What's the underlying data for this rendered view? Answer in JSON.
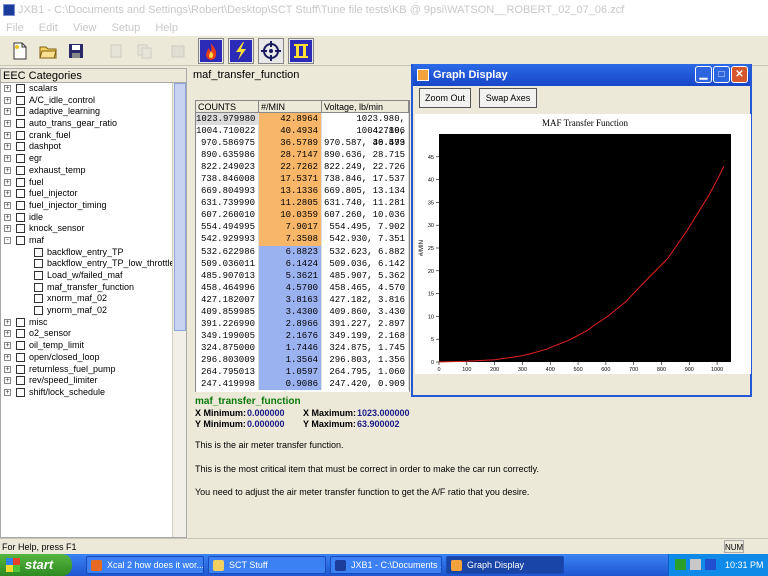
{
  "window": {
    "title": "JXB1 - C:\\Documents and Settings\\Robert\\Desktop\\SCT Stuff\\Tune file tests\\KB @ 9psi\\WATSON__ROBERT_02_07_06.zcf"
  },
  "menu": [
    "File",
    "Edit",
    "View",
    "Setup",
    "Help"
  ],
  "toolbar": {
    "icons": [
      "new-file-icon",
      "open-folder-icon",
      "save-icon",
      "cut-icon",
      "copy-icon",
      "paste-icon",
      "flame-icon",
      "lightning-icon",
      "target-icon",
      "pause-icon"
    ]
  },
  "left": {
    "header": "EEC Categories",
    "tree": [
      {
        "label": "scalars",
        "expander": "+",
        "level": 0
      },
      {
        "label": "A/C_idle_control",
        "expander": "+",
        "level": 0
      },
      {
        "label": "adaptive_learning",
        "expander": "+",
        "level": 0
      },
      {
        "label": "auto_trans_gear_ratio",
        "expander": "+",
        "level": 0
      },
      {
        "label": "crank_fuel",
        "expander": "+",
        "level": 0
      },
      {
        "label": "dashpot",
        "expander": "+",
        "level": 0
      },
      {
        "label": "egr",
        "expander": "+",
        "level": 0
      },
      {
        "label": "exhaust_temp",
        "expander": "+",
        "level": 0
      },
      {
        "label": "fuel",
        "expander": "+",
        "level": 0
      },
      {
        "label": "fuel_injector",
        "expander": "+",
        "level": 0
      },
      {
        "label": "fuel_injector_timing",
        "expander": "+",
        "level": 0
      },
      {
        "label": "idle",
        "expander": "+",
        "level": 0
      },
      {
        "label": "knock_sensor",
        "expander": "+",
        "level": 0
      },
      {
        "label": "maf",
        "expander": "-",
        "level": 0
      },
      {
        "label": "backflow_entry_TP",
        "expander": "",
        "level": 1
      },
      {
        "label": "backflow_entry_TP_low_throttle",
        "expander": "",
        "level": 1
      },
      {
        "label": "Load_w/failed_maf",
        "expander": "",
        "level": 1
      },
      {
        "label": "maf_transfer_function",
        "expander": "",
        "level": 1
      },
      {
        "label": "xnorm_maf_02",
        "expander": "",
        "level": 1
      },
      {
        "label": "ynorm_maf_02",
        "expander": "",
        "level": 1
      },
      {
        "label": "misc",
        "expander": "+",
        "level": 0
      },
      {
        "label": "o2_sensor",
        "expander": "+",
        "level": 0
      },
      {
        "label": "oil_temp_limit",
        "expander": "+",
        "level": 0
      },
      {
        "label": "open/closed_loop",
        "expander": "+",
        "level": 0
      },
      {
        "label": "returnless_fuel_pump",
        "expander": "+",
        "level": 0
      },
      {
        "label": "rev/speed_limiter",
        "expander": "+",
        "level": 0
      },
      {
        "label": "shift/lock_schedule",
        "expander": "+",
        "level": 0
      }
    ]
  },
  "main": {
    "header": "maf_transfer_function",
    "columns": [
      "COUNTS",
      "#/MIN",
      "Voltage, lb/min"
    ],
    "rows": [
      [
        "1023.979980",
        "42.8964",
        "1023.980, 42.896"
      ],
      [
        "1004.710022",
        "40.4934",
        "1004.710, 40.493"
      ],
      [
        "970.586975",
        "36.5789",
        "970.587, 36.579"
      ],
      [
        "890.635986",
        "28.7147",
        "890.636, 28.715"
      ],
      [
        "822.249023",
        "22.7262",
        "822.249, 22.726"
      ],
      [
        "738.846008",
        "17.5371",
        "738.846, 17.537"
      ],
      [
        "669.804993",
        "13.1336",
        "669.805, 13.134"
      ],
      [
        "631.739990",
        "11.2805",
        "631.740, 11.281"
      ],
      [
        "607.260010",
        "10.0359",
        "607.260, 10.036"
      ],
      [
        "554.494995",
        "7.9017",
        "554.495, 7.902"
      ],
      [
        "542.929993",
        "7.3508",
        "542.930, 7.351"
      ],
      [
        "532.622986",
        "6.8823",
        "532.623, 6.882"
      ],
      [
        "509.036011",
        "6.1424",
        "509.036, 6.142"
      ],
      [
        "485.907013",
        "5.3621",
        "485.907, 5.362"
      ],
      [
        "458.464996",
        "4.5700",
        "458.465, 4.570"
      ],
      [
        "427.182007",
        "3.8163",
        "427.182, 3.816"
      ],
      [
        "409.859985",
        "3.4300",
        "409.860, 3.430"
      ],
      [
        "391.226990",
        "2.8966",
        "391.227, 2.897"
      ],
      [
        "349.199005",
        "2.1676",
        "349.199, 2.168"
      ],
      [
        "324.875000",
        "1.7446",
        "324.875, 1.745"
      ],
      [
        "296.803009",
        "1.3564",
        "296.803, 1.356"
      ],
      [
        "264.795013",
        "1.0597",
        "264.795, 1.060"
      ],
      [
        "247.419998",
        "0.9086",
        "247.420, 0.909"
      ]
    ],
    "highlight_orange_rows": 11,
    "colors": {
      "orange": "#f8b768",
      "blue": "#9bb2f0"
    }
  },
  "info": {
    "title": "maf_transfer_function",
    "x_min_label": "X Minimum:",
    "x_min": "0.000000",
    "x_max_label": "X Maximum:",
    "x_max": "1023.000000",
    "y_min_label": "Y Minimum:",
    "y_min": "0.000000",
    "y_max_label": "Y Maximum:",
    "y_max": "63.900002",
    "lines": [
      "This is the air meter transfer function.",
      "This is the most critical item that must be correct in order to make the car run correctly.",
      "You need to adjust the air meter transfer function to get the A/F ratio that you desire."
    ]
  },
  "graph": {
    "window_title": "Graph Display",
    "zoom_out": "Zoom Out",
    "swap_axes": "Swap Axes",
    "chart_data": {
      "type": "line",
      "title": "MAF Transfer Function",
      "xlabel": "COUNTS",
      "ylabel": "#/MIN",
      "xlim": [
        0,
        1050
      ],
      "ylim": [
        0,
        50
      ],
      "xticks": [
        0,
        100,
        200,
        300,
        400,
        500,
        600,
        700,
        800,
        900,
        1000
      ],
      "yticks": [
        0,
        5,
        10,
        15,
        20,
        25,
        30,
        35,
        40,
        45
      ],
      "series": [
        {
          "color": "#e02020",
          "x": [
            0,
            100,
            200,
            247.42,
            264.8,
            296.8,
            324.88,
            349.2,
            391.23,
            409.86,
            427.18,
            458.46,
            485.91,
            509.04,
            532.62,
            542.93,
            554.49,
            607.26,
            631.74,
            669.8,
            738.85,
            822.25,
            890.64,
            970.59,
            1004.71,
            1023.98
          ],
          "y": [
            0,
            0.15,
            0.5,
            0.9086,
            1.0597,
            1.3564,
            1.7446,
            2.1676,
            2.8966,
            3.43,
            3.8163,
            4.57,
            5.3621,
            6.1424,
            6.8823,
            7.3508,
            7.9017,
            10.0359,
            11.2805,
            13.1336,
            17.5371,
            22.7262,
            28.7147,
            36.5789,
            40.4934,
            42.8964
          ]
        }
      ]
    }
  },
  "status": {
    "help": "For Help, press F1",
    "num": "NUM"
  },
  "taskbar": {
    "start": "start",
    "tasks": [
      {
        "label": "Xcal 2 how does it wor...",
        "active": false
      },
      {
        "label": "SCT Stuff",
        "active": false
      },
      {
        "label": "JXB1 - C:\\Documents ...",
        "active": false
      },
      {
        "label": "Graph Display",
        "active": true
      }
    ],
    "clock": "10:31 PM"
  }
}
